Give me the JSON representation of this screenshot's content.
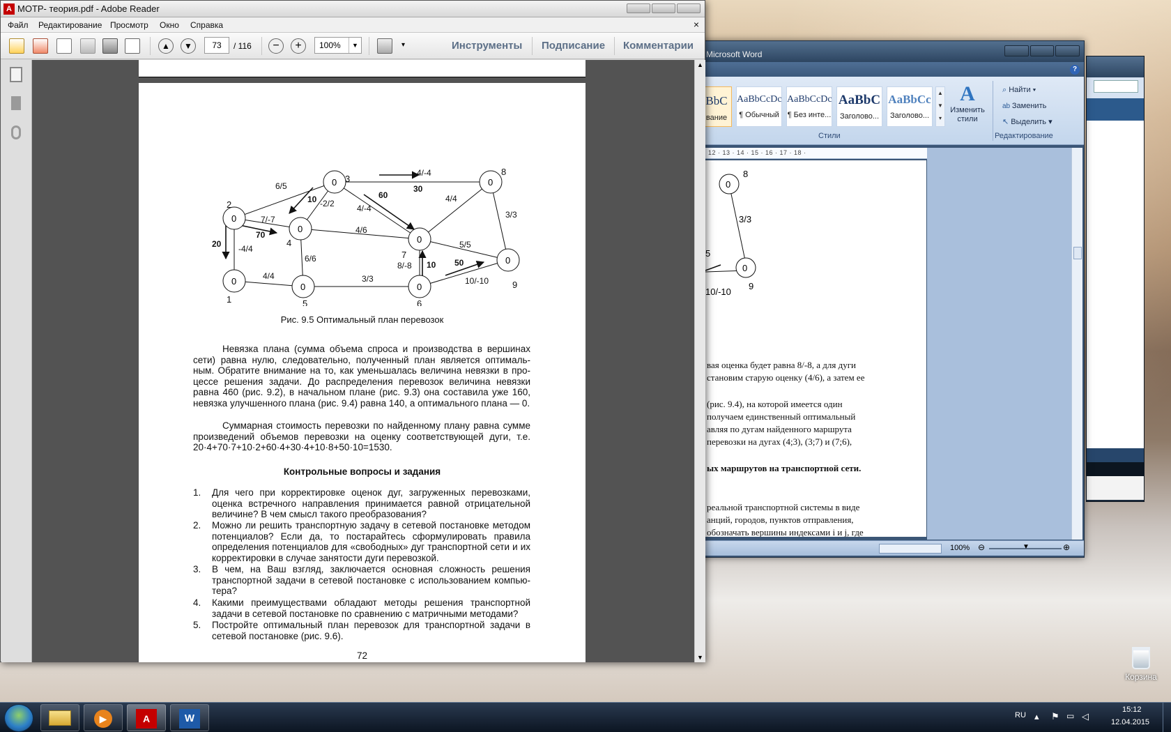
{
  "word": {
    "title": "Microsoft Word",
    "styles": [
      {
        "sample": "BbC",
        "name": "вание"
      },
      {
        "sample": "AaBbCcDc",
        "name": "¶ Обычный"
      },
      {
        "sample": "AaBbCcDc",
        "name": "¶ Без инте..."
      },
      {
        "sample": "AaBbC",
        "name": "Заголово..."
      },
      {
        "sample": "AaBbCc",
        "name": "Заголово..."
      }
    ],
    "change_styles": "Изменить стили",
    "styles_group": "Стили",
    "find": "Найти",
    "replace": "Заменить",
    "select": "Выделить",
    "editing_group": "Редактирование",
    "ruler": "12 · 13 · 14 · 15 · 16 · 17 · 18 ·",
    "zoom": "100%",
    "graph_labels": {
      "n8": "8",
      "v8": "0",
      "e1": "3/3",
      "e2": "5",
      "e3": "10/-10",
      "n9": "9",
      "v9": "0"
    },
    "text_lines": [
      "вая оценка будет равна 8/-8, а для дуги",
      "становим старую оценку (4/6), а затем ее",
      "(рис. 9.4), на которой имеется один",
      "получаем единственный оптимальный",
      "авляя по дугам найденного маршрута",
      "перевозки на дугах (4;3), (3;7) и (7;6),",
      "ых маршрутов на транспортной сети.",
      "реальной транспортной системы в виде",
      "анций, городов, пунктов отправления,",
      "обозначать вершины индексами i и j, где"
    ]
  },
  "adobe": {
    "title": "МОТР- теория.pdf - Adobe Reader",
    "menu": [
      "Файл",
      "Редактирование",
      "Просмотр",
      "Окно",
      "Справка"
    ],
    "close": "×",
    "page_current": "73",
    "page_total": "/ 116",
    "zoom": "100%",
    "tools": "Инструменты",
    "sign": "Подписание",
    "comments": "Комментарии"
  },
  "doc": {
    "graph": {
      "node_value": "0",
      "node_labels": [
        "1",
        "2",
        "3",
        "4",
        "5",
        "6",
        "7",
        "8",
        "9"
      ],
      "edge_labels": {
        "e23": "6/5",
        "e38": "4/-4",
        "flow38": "30",
        "e34": "10",
        "e34b": "-2/2",
        "e37": "4/-4",
        "flow37": "60",
        "e78": "4/4",
        "e89": "3/3",
        "e24": "7/-7",
        "flow24": "70",
        "e21": "-4/4",
        "flow21": "20",
        "e47": "4/6",
        "e45": "6/6",
        "e79": "5/5",
        "e67": "8/-8",
        "flow67": "10",
        "e15": "4/4",
        "e56": "3/3",
        "flow69": "50",
        "e69": "10/-10"
      }
    },
    "caption": "Рис. 9.5 Оптимальный план перевозок",
    "para1": "Невязка плана (сумма объема спроса и производства в вершинах сети) равна нулю, следовательно, полученный план является оптималь-ным. Обратите внимание на то, как уменьшалась величина невязки в про-цессе решения задачи. До распределения перевозок величина невязки равна 460 (рис. 9.2), в начальном плане (рис. 9.3) она составила уже 160, невязка улучшенного плана (рис. 9.4) равна 140, а оптимального плана — 0.",
    "para2": "Суммарная стоимость перевозки по найденному плану равна сумме произведений объемов перевозки на оценку соответствующей дуги, т.е. 20·4+70·7+10·2+60·4+30·4+10·8+50·10=1530.",
    "heading": "Контрольные вопросы и задания",
    "questions": [
      {
        "n": "1.",
        "t": "Для чего при корректировке оценок дуг, загруженных перевозками, оценка встречного направления принимается равной отрицательной величине? В чем смысл такого преобразования?"
      },
      {
        "n": "2.",
        "t": "Можно ли решить транспортную задачу в сетевой постановке методом потенциалов? Если да, то постарайтесь сформулировать правила определения потенциалов для «свободных» дуг транспортной сети и их корректировки в случае занятости дуги перевозкой."
      },
      {
        "n": "3.",
        "t": "В чем, на Ваш взгляд, заключается основная сложность решения транспортной задачи в сетевой постановке с использованием компью-тера?"
      },
      {
        "n": "4.",
        "t": "Какими преимуществами обладают методы решения транспортной задачи в сетевой постановке по сравнению с матричными методами?"
      },
      {
        "n": "5.",
        "t": "Постройте оптимальный план перевозок для транспортной задачи в сетевой постановке (рис. 9.6)."
      }
    ],
    "page_number": "72"
  },
  "desktop": {
    "recycle_bin": "Корзина"
  },
  "taskbar": {
    "lang": "RU",
    "time": "15:12",
    "date": "12.04.2015"
  }
}
